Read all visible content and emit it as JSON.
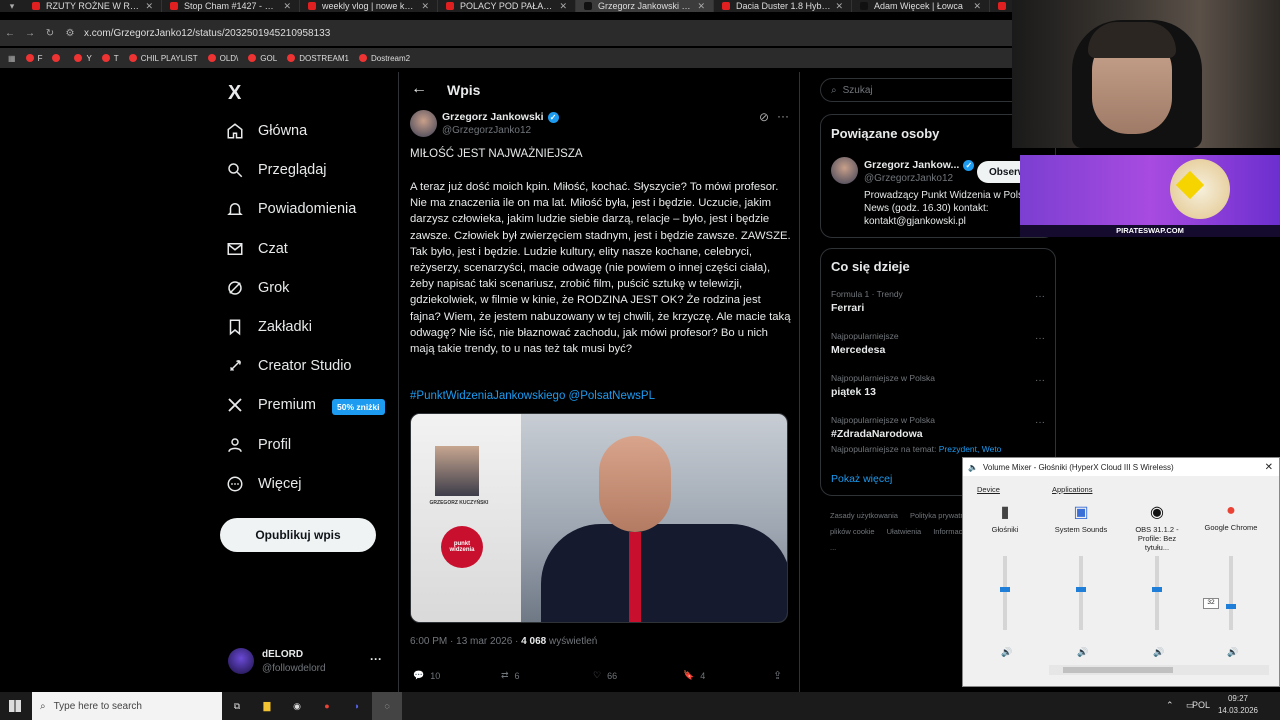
{
  "browser": {
    "tabs": [
      {
        "title": "RZUTY ROŻNE W ROLI GŁÓWNEJ",
        "color": "#e02020"
      },
      {
        "title": "Stop Cham #1427 - Niebezpieczne",
        "color": "#e02020"
      },
      {
        "title": "weekly vlog | nowe książki",
        "color": "#e02020"
      },
      {
        "title": "POLACY POD PAŁACEM!",
        "color": "#e02020"
      },
      {
        "title": "Grzegorz Jankowski w X",
        "color": "#111111",
        "active": true
      },
      {
        "title": "Dacia Duster 1.8 Hybrid",
        "color": "#e02020"
      },
      {
        "title": "Adam Więcek | Łowca",
        "color": "#111111"
      },
      {
        "title": "...",
        "color": "#e02020"
      }
    ],
    "url": "x.com/GrzegorzJanko12/status/2032501945210958133",
    "bookmarks": [
      "F",
      "",
      "Y",
      "T",
      "CHIL PLAYLIST",
      "OLD\\",
      "GOL",
      "DOSTREAM1",
      "Dostream2"
    ]
  },
  "nav": {
    "logo": "X",
    "items": [
      {
        "label": "Główna",
        "icon": "home-icon"
      },
      {
        "label": "Przeglądaj",
        "icon": "search-icon"
      },
      {
        "label": "Powiadomienia",
        "icon": "bell-icon"
      },
      {
        "label": "Czat",
        "icon": "mail-icon"
      },
      {
        "label": "Grok",
        "icon": "grok-icon"
      },
      {
        "label": "Zakładki",
        "icon": "bookmark-icon"
      },
      {
        "label": "Creator Studio",
        "icon": "rocket-icon"
      },
      {
        "label": "Premium",
        "icon": "x-icon"
      },
      {
        "label": "Profil",
        "icon": "person-icon"
      },
      {
        "label": "Więcej",
        "icon": "more-circle-icon"
      }
    ],
    "premium_badge": "50% zniżki",
    "post_button": "Opublikuj wpis",
    "account": {
      "name": "dELORD",
      "handle": "@followdelord"
    }
  },
  "post": {
    "header_title": "Wpis",
    "author_name": "Grzegorz Jankowski",
    "author_handle": "@GrzegorzJanko12",
    "headline": "MIŁOŚĆ JEST NAJWAŻNIEJSZA",
    "body": "A teraz już dość moich kpin. Miłość, kochać. Słyszycie? To mówi profesor. Nie ma znaczenia ile on ma lat. Miłość była, jest i będzie. Uczucie, jakim darzysz człowieka, jakim ludzie siebie darzą, relacje – było, jest i będzie zawsze. Człowiek był zwierzęciem stadnym, jest i będzie zawsze. ZAWSZE. Tak było, jest i będzie. Ludzie kultury, elity nasze kochane, celebryci, reżyserzy, scenarzyści, macie odwagę (nie powiem o innej części ciała), żeby napisać taki scenariusz, zrobić film, puścić sztukę w telewizji, gdziekolwiek, w filmie w kinie, że RODZINA JEST OK? Że rodzina jest fajna? Wiem, że jestem nabuzowany w tej chwili, że krzyczę. Ale macie taką odwagę? Nie iść, nie błaznować zachodu, jak mówi profesor? Bo u nich mają takie trendy, to u nas też tak musi być?",
    "hashtags": "#PunktWidzeniaJankowskiego @PolsatNewsPL",
    "video_caption_name": "GRZEGORZ KUCZYŃSKI",
    "video_logo": "punkt widzenia",
    "time": "6:00 PM · 13 mar 2026 · ",
    "views": "4 068",
    "views_label": " wyświetleń",
    "stats": {
      "replies": "10",
      "reposts": "6",
      "likes": "66",
      "bookmarks": "4"
    }
  },
  "search": {
    "placeholder": "Szukaj"
  },
  "related": {
    "title": "Powiązane osoby",
    "name": "Grzegorz Jankow...",
    "handle": "@GrzegorzJanko12",
    "follow": "Obserwuj",
    "bio": "Prowadzący Punkt Widzenia w Polsat News (godz. 16.30) kontakt: kontakt@gjankowski.pl"
  },
  "trends": {
    "title": "Co się dzieje",
    "items": [
      {
        "context": "Formula 1 · Trendy",
        "name": "Ferrari"
      },
      {
        "context": "Najpopularniejsze",
        "name": "Mercedesa"
      },
      {
        "context": "Najpopularniejsze w Polska",
        "name": "piątek 13"
      },
      {
        "context": "Najpopularniejsze w Polska",
        "name": "#ZdradaNarodowa",
        "extra": "Najpopularniejsze na temat: ",
        "extra_links": "Prezydent, Weto"
      }
    ],
    "show_more": "Pokaż więcej"
  },
  "footer_links": [
    "Zasady użytkowania",
    "Polityka prywatności",
    "Polityka dotycząca plików cookie",
    "Ułatwienia",
    "Informacja o reklamach",
    "Więcej ..."
  ],
  "ad": {
    "text": "PIRATESWAP.COM"
  },
  "mixer": {
    "title": "Volume Mixer - Głośniki (HyperX Cloud III S Wireless)",
    "device_label": "Device",
    "apps_label": "Applications",
    "columns": [
      {
        "name": "Głośniki",
        "level": 0.55
      },
      {
        "name": "System Sounds",
        "level": 0.55
      },
      {
        "name": "OBS 31.1.2 - Profile: Bez tytułu...",
        "level": 0.55
      },
      {
        "name": "Google Chrome",
        "level": 0.32
      }
    ],
    "tooltip": "32"
  },
  "taskbar": {
    "search_placeholder": "Type here to search",
    "lang": "POL",
    "time": "09:27",
    "date": "14.03.2026"
  }
}
